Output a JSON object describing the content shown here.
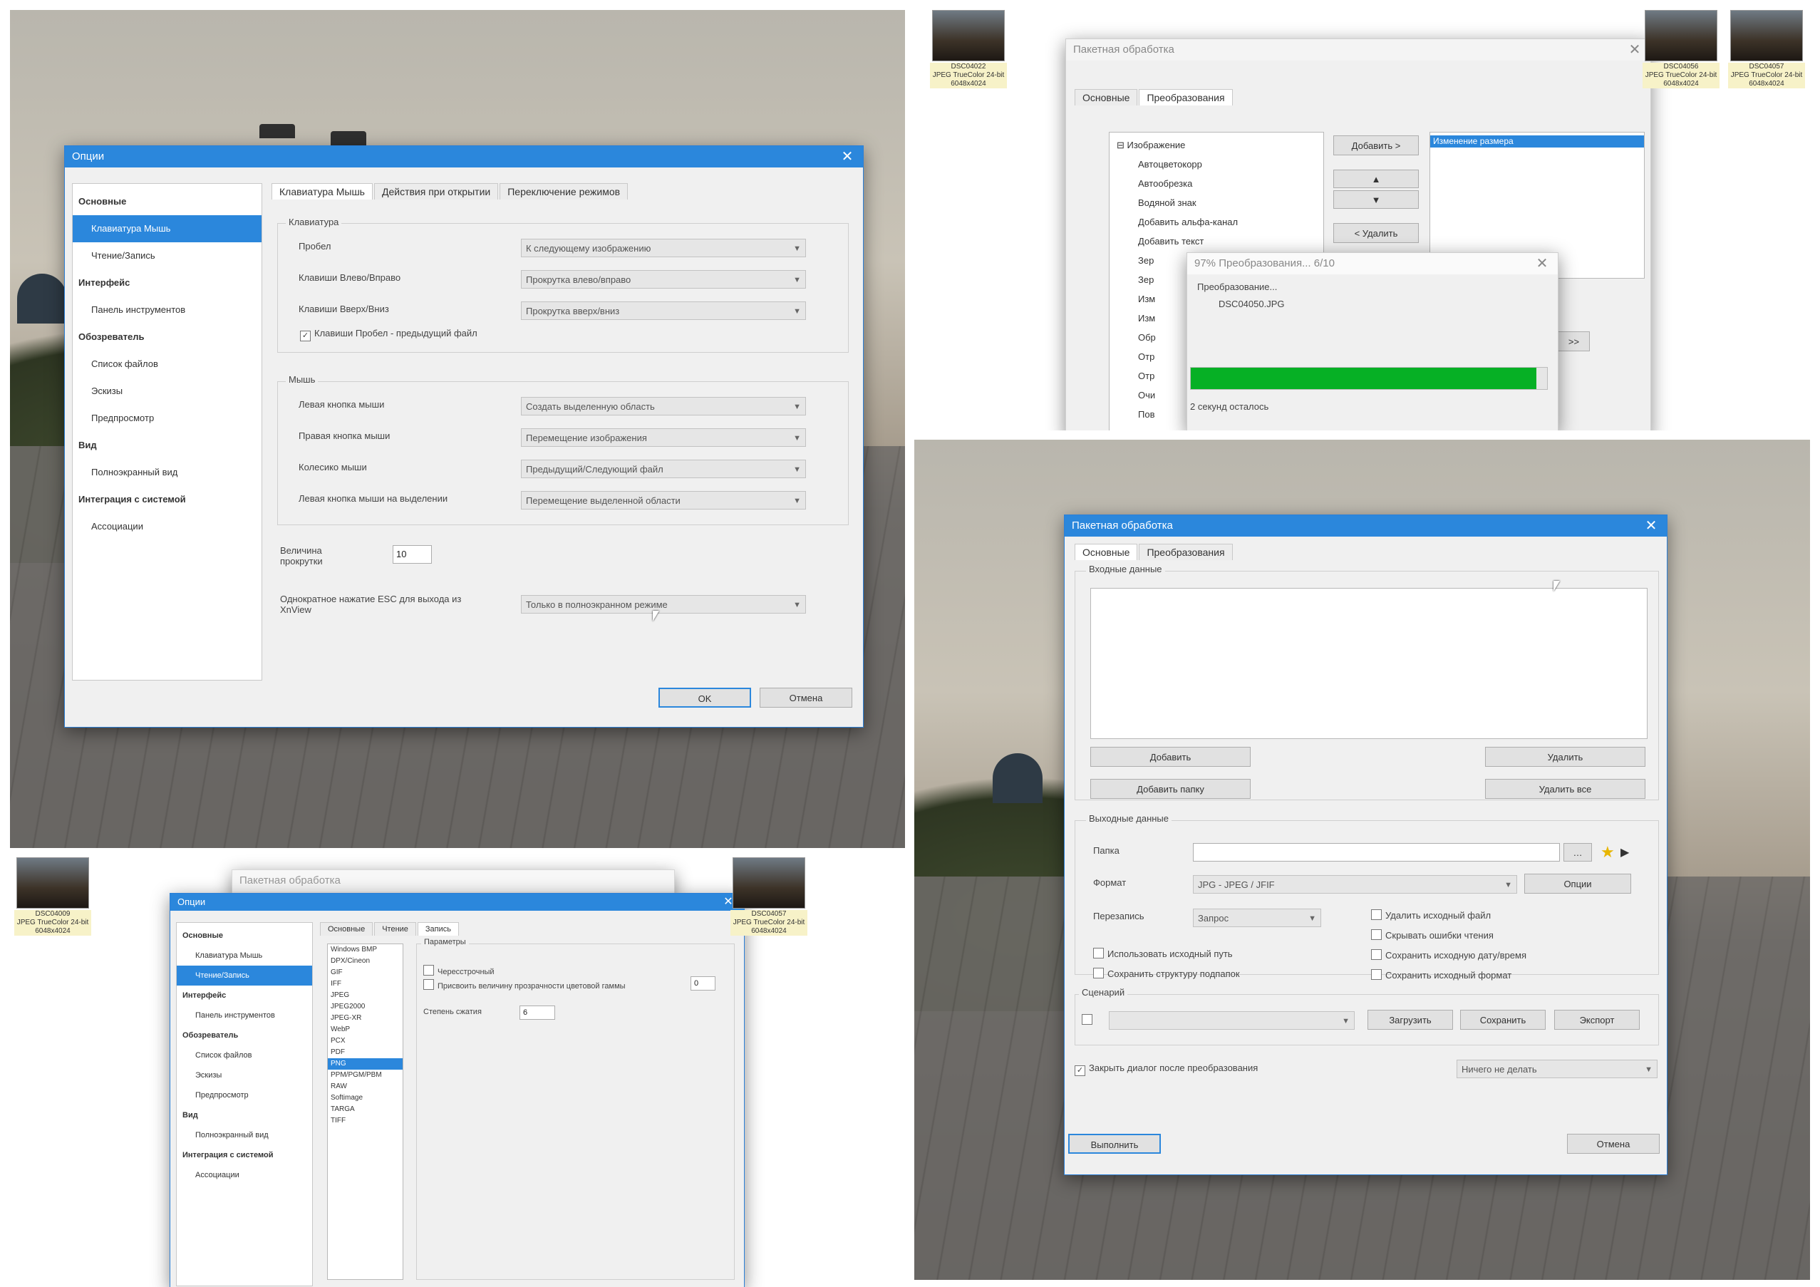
{
  "panel1": {
    "dialog": {
      "title": "Опции",
      "sidebar": [
        {
          "label": "Основные",
          "kind": "bold"
        },
        {
          "label": "Клавиатура Мышь",
          "kind": "sel"
        },
        {
          "label": "Чтение/Запись",
          "kind": "sub"
        },
        {
          "label": "Интерфейс",
          "kind": "bold"
        },
        {
          "label": "Панель инструментов",
          "kind": "sub"
        },
        {
          "label": "Обозреватель",
          "kind": "bold"
        },
        {
          "label": "Список файлов",
          "kind": "sub"
        },
        {
          "label": "Эскизы",
          "kind": "sub"
        },
        {
          "label": "Предпросмотр",
          "kind": "sub"
        },
        {
          "label": "Вид",
          "kind": "bold"
        },
        {
          "label": "Полноэкранный вид",
          "kind": "sub"
        },
        {
          "label": "Интеграция с системой",
          "kind": "bold"
        },
        {
          "label": "Ассоциации",
          "kind": "sub"
        }
      ],
      "tabs": [
        "Клавиатура Мышь",
        "Действия при открытии",
        "Переключение режимов"
      ],
      "keyboard_group": "Клавиатура",
      "keyboard_rows": [
        {
          "label": "Пробел",
          "value": "К следующему изображению"
        },
        {
          "label": "Клавиши Влево/Вправо",
          "value": "Прокрутка влево/вправо"
        },
        {
          "label": "Клавиши Вверх/Вниз",
          "value": "Прокрутка вверх/вниз"
        }
      ],
      "checkbox_space": "Клавиши Пробел - предыдущий файл",
      "mouse_group": "Мышь",
      "mouse_rows": [
        {
          "label": "Левая кнопка мыши",
          "value": "Создать выделенную область"
        },
        {
          "label": "Правая кнопка мыши",
          "value": "Перемещение изображения"
        },
        {
          "label": "Колесико мыши",
          "value": "Предыдущий/Следующий файл"
        },
        {
          "label": "Левая кнопка мыши на выделении",
          "value": "Перемещение выделенной области"
        }
      ],
      "scroll_label": "Величина прокрутки",
      "scroll_value": "10",
      "esc_label": "Однократное нажатие ESC для выхода из XnView",
      "esc_value": "Только в полноэкранном режиме",
      "ok": "OK",
      "cancel": "Отмена"
    }
  },
  "panel2": {
    "thumbs": [
      {
        "name": "DSC04022",
        "meta": "JPEG TrueColor 24-bit",
        "dims": "6048x4024"
      },
      {
        "name": "DSC04056",
        "meta": "JPEG TrueColor 24-bit",
        "dims": "6048x4024"
      },
      {
        "name": "DSC04057",
        "meta": "JPEG TrueColor 24-bit",
        "dims": "6048x4024"
      }
    ],
    "batch": {
      "title": "Пакетная обработка",
      "tabs": [
        "Основные",
        "Преобразования"
      ],
      "tree": [
        "Изображение",
        "Автоцветокорр",
        "Автообрезка",
        "Водяной знак",
        "Добавить альфа-канал",
        "Добавить текст",
        "Зер",
        "Зер",
        "Изм",
        "Изм",
        "Обр",
        "Отр",
        "Отр",
        "Очи",
        "Пов"
      ],
      "add_btn": "Добавить >",
      "remove_btn": "< Удалить",
      "selected": [
        "Изменение размера"
      ],
      "up": "▲",
      "down": "▼",
      "more": ">>"
    },
    "progress": {
      "title": "97% Преобразования... 6/10",
      "line1": "Преобразование...",
      "line2": "DSC04050.JPG",
      "percent": 0.97,
      "remaining": "2 секунд осталось"
    }
  },
  "panel3": {
    "dialog": {
      "title": "Опции",
      "sidebar": [
        {
          "label": "Основные",
          "kind": "bold"
        },
        {
          "label": "Клавиатура Мышь",
          "kind": "sub"
        },
        {
          "label": "Чтение/Запись",
          "kind": "sel"
        },
        {
          "label": "Интерфейс",
          "kind": "bold"
        },
        {
          "label": "Панель инструментов",
          "kind": "sub"
        },
        {
          "label": "Обозреватель",
          "kind": "bold"
        },
        {
          "label": "Список файлов",
          "kind": "sub"
        },
        {
          "label": "Эскизы",
          "kind": "sub"
        },
        {
          "label": "Предпросмотр",
          "kind": "sub"
        },
        {
          "label": "Вид",
          "kind": "bold"
        },
        {
          "label": "Полноэкранный вид",
          "kind": "sub"
        },
        {
          "label": "Интеграция с системой",
          "kind": "bold"
        },
        {
          "label": "Ассоциации",
          "kind": "sub"
        }
      ],
      "tabs": [
        "Основные",
        "Чтение",
        "Запись"
      ],
      "formats": [
        "Windows BMP",
        "DPX/Cineon",
        "GIF",
        "IFF",
        "JPEG",
        "JPEG2000",
        "JPEG-XR",
        "WebP",
        "PCX",
        "PDF",
        "PNG",
        "PPM/PGM/PBM",
        "RAW",
        "Softimage",
        "TARGA",
        "TIFF"
      ],
      "selected_format": "PNG",
      "group_label": "Параметры",
      "opt_interlaced": "Чересстрочный",
      "opt_transparency": "Присвоить величину прозрачности цветовой гаммы",
      "transparency_value": "0",
      "compression_label": "Степень сжатия",
      "compression_value": "6"
    },
    "bg_title": "Пакетная обработка",
    "thumbs": [
      {
        "name": "DSC04009",
        "meta": "JPEG TrueColor 24-bit",
        "dims": "6048x4024"
      },
      {
        "name": "DSC04057",
        "meta": "JPEG TrueColor 24-bit",
        "dims": "6048x4024"
      }
    ]
  },
  "panel4": {
    "dialog": {
      "title": "Пакетная обработка",
      "tabs": [
        "Основные",
        "Преобразования"
      ],
      "input_label": "Входные данные",
      "add": "Добавить",
      "add_folder": "Добавить папку",
      "remove": "Удалить",
      "remove_all": "Удалить все",
      "output_label": "Выходные данные",
      "folder_label": "Папка",
      "format_label": "Формат",
      "format_value": "JPG - JPEG / JFIF",
      "options": "Опции",
      "overwrite_label": "Перезапись",
      "overwrite_value": "Запрос",
      "checks_left": [
        "Использовать исходный путь",
        "Сохранить структуру подпапок"
      ],
      "checks_right": [
        "Удалить исходный файл",
        "Скрывать ошибки чтения",
        "Сохранить исходную дату/время",
        "Сохранить исходный формат"
      ],
      "script_label": "Сценарий",
      "load": "Загрузить",
      "save": "Сохранить",
      "export": "Экспорт",
      "close_after": "Закрыть диалог после преобразования",
      "after_value": "Ничего не делать",
      "run": "Выполнить",
      "cancel": "Отмена"
    }
  }
}
